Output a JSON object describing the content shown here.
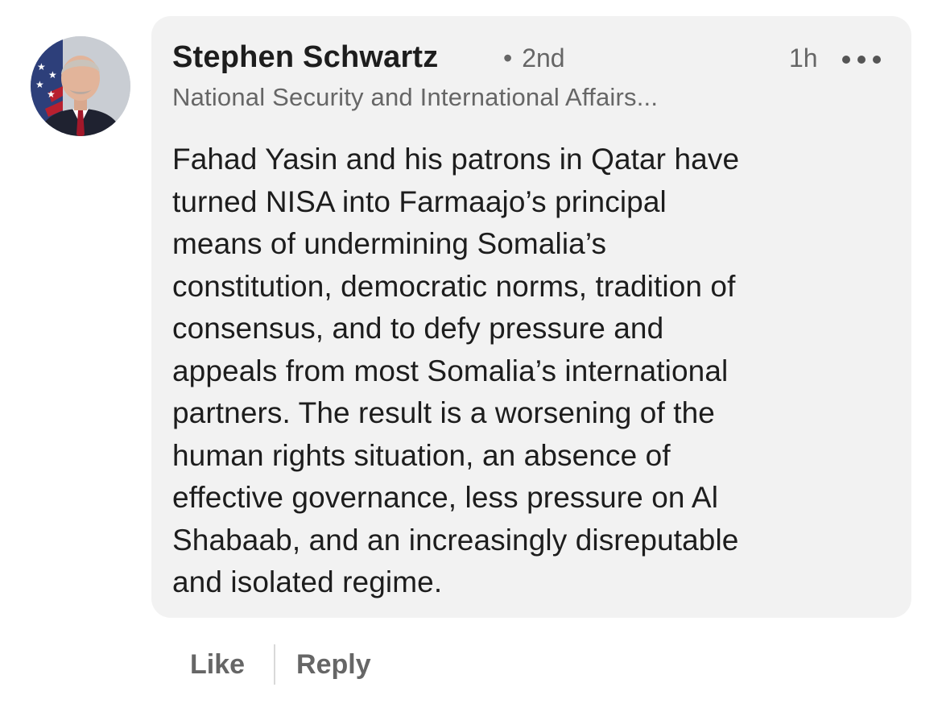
{
  "comment": {
    "author": {
      "name": "Stephen Schwartz",
      "degree": "2nd",
      "headline": "National Security and International Affairs..."
    },
    "time": "1h",
    "body_lines": [
      "Fahad Yasin and his patrons in Qatar have",
      "turned NISA into Farmaajo’s principal",
      "means of undermining Somalia’s",
      "constitution, democratic norms, tradition of",
      "consensus, and to defy pressure and",
      "appeals from most Somalia’s international",
      "partners. The result is a worsening of the",
      "human rights situation, an absence of",
      "effective governance, less pressure on Al",
      "Shabaab, and an increasingly disreputable",
      "and isolated regime."
    ]
  },
  "actions": {
    "like": "Like",
    "reply": "Reply"
  },
  "icons": {
    "more": "more-horizontal-icon"
  },
  "colors": {
    "bubble_background": "#f2f2f2",
    "primary_text": "#1d1d1d",
    "secondary_text": "#666666"
  }
}
